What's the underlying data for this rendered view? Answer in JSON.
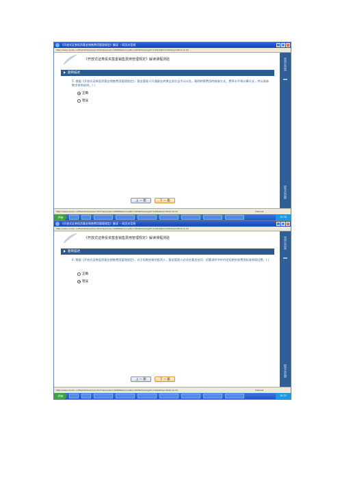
{
  "screens": [
    {
      "window_title": "《开放式证券投资基金销售费用管理规定》解读 -- 网页对话框",
      "address": "http://www.cscsdc.cn/FlashOnline/Quiz.htm?UserCode=100896&CourseNo=1009&TrainingID=1001&QKind=0&tmp=2010-12-19",
      "course_title": "《开放式证券投资基金销售费用管理规定》解读课程测验",
      "section_header": "题目描述",
      "question": "5. 根据《开放式证券投资基金销售费用管理规定》，基金管理人开通基金转换业务应当予以公告，载明转换费用的收取方式、费率水平和计算公式，并以具体数字举例说明。(    )",
      "options": [
        "正确",
        "错误"
      ],
      "selected": 0,
      "prev_label": "上 一 题",
      "next_label": "下 一 题",
      "sidebar_top": "显示答案",
      "sidebar_bottom": "提交答题",
      "status_url": "http://www.cscsdc.cn/FlashOnline/Quiz.htm?UserCode=100896&CourseNo=1009&TrainingID=1001&tmp=2010-12-19",
      "status_zone": "Internet",
      "start_label": "开始",
      "clock": "15:30"
    },
    {
      "window_title": "《开放式证券投资基金销售费用管理规定》解读 -- 网页对话框",
      "address": "http://www.cscsdc.cn/FlashOnline/Quiz.htm?UserCode=100896&CourseNo=1009&TrainingID=1001&QKind=0&tmp=2010-12-19",
      "course_title": "《开放式证券投资基金销售费用管理规定》解读课程测验",
      "section_header": "题目描述",
      "question": "6. 根据《开放式证券投资基金销售费用管理规定》，对于短期交易的投资人，基金管理人必须在基金合同、招募说明书中约定短期交易费用标准和赎回费。(    )",
      "options": [
        "正确",
        "错误"
      ],
      "selected": 1,
      "prev_label": "上 一 题",
      "next_label": "下 一 题",
      "sidebar_top": "显示答案",
      "sidebar_bottom": "提交答题",
      "status_url": "http://www.cscsdc.cn/FlashOnline/Quiz.htm?UserCode=100896&CourseNo=1009&TrainingID=1001&tmp=2010-12-19",
      "status_zone": "Internet",
      "start_label": "开始",
      "clock": "15:31"
    }
  ]
}
